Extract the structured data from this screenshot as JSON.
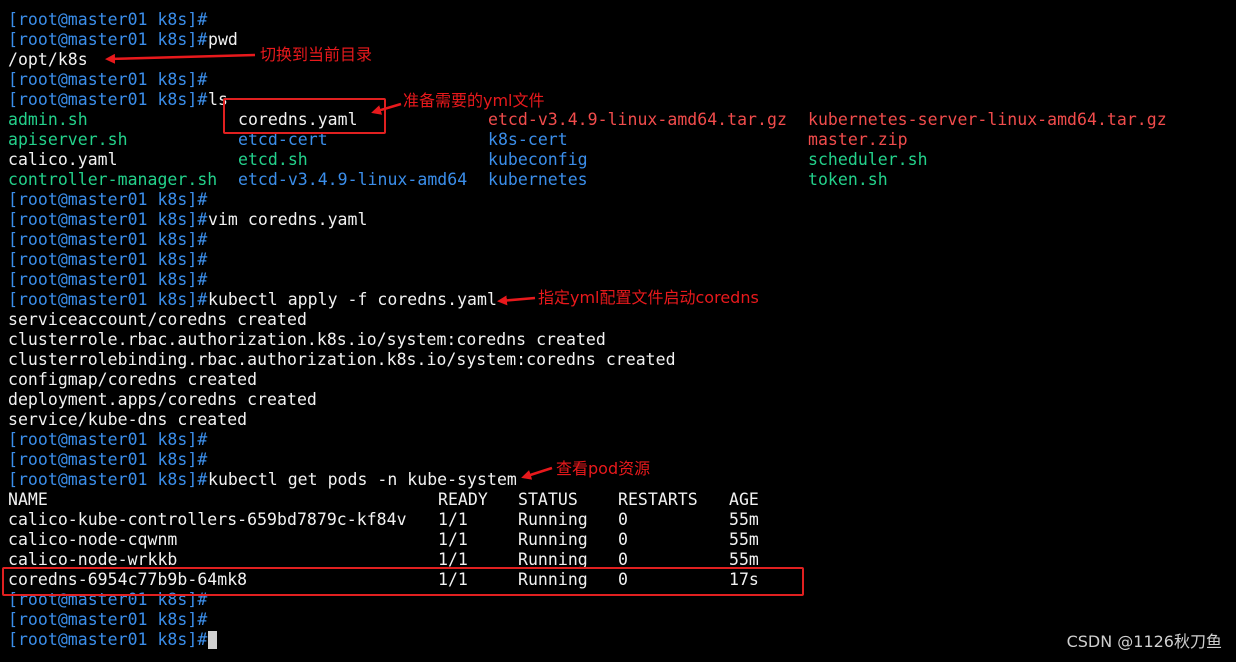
{
  "terminal": {
    "prompt": "[root@master01 k8s]#",
    "lines": [
      {
        "type": "prompt",
        "cmd": ""
      },
      {
        "type": "prompt",
        "cmd": "pwd"
      },
      {
        "type": "output",
        "text": "/opt/k8s"
      },
      {
        "type": "prompt",
        "cmd": ""
      },
      {
        "type": "prompt",
        "cmd": "ls"
      },
      {
        "type": "ls",
        "cells": [
          {
            "text": "admin.sh",
            "color": "green"
          },
          {
            "text": "coredns.yaml",
            "color": "white"
          },
          {
            "text": "etcd-v3.4.9-linux-amd64.tar.gz",
            "color": "red"
          },
          {
            "text": "kubernetes-server-linux-amd64.tar.gz",
            "color": "red"
          }
        ]
      },
      {
        "type": "ls",
        "cells": [
          {
            "text": "apiserver.sh",
            "color": "green"
          },
          {
            "text": "etcd-cert",
            "color": "blue"
          },
          {
            "text": "k8s-cert",
            "color": "blue"
          },
          {
            "text": "master.zip",
            "color": "red"
          }
        ]
      },
      {
        "type": "ls",
        "cells": [
          {
            "text": "calico.yaml",
            "color": "white"
          },
          {
            "text": "etcd.sh",
            "color": "green"
          },
          {
            "text": "kubeconfig",
            "color": "blue"
          },
          {
            "text": "scheduler.sh",
            "color": "green"
          }
        ]
      },
      {
        "type": "ls",
        "cells": [
          {
            "text": "controller-manager.sh",
            "color": "green"
          },
          {
            "text": "etcd-v3.4.9-linux-amd64",
            "color": "blue"
          },
          {
            "text": "kubernetes",
            "color": "blue"
          },
          {
            "text": "token.sh",
            "color": "green"
          }
        ]
      },
      {
        "type": "prompt",
        "cmd": ""
      },
      {
        "type": "prompt",
        "cmd": "vim coredns.yaml"
      },
      {
        "type": "prompt",
        "cmd": ""
      },
      {
        "type": "prompt",
        "cmd": ""
      },
      {
        "type": "prompt",
        "cmd": ""
      },
      {
        "type": "prompt",
        "cmd": "kubectl apply -f coredns.yaml"
      },
      {
        "type": "output",
        "text": "serviceaccount/coredns created"
      },
      {
        "type": "output",
        "text": "clusterrole.rbac.authorization.k8s.io/system:coredns created"
      },
      {
        "type": "output",
        "text": "clusterrolebinding.rbac.authorization.k8s.io/system:coredns created"
      },
      {
        "type": "output",
        "text": "configmap/coredns created"
      },
      {
        "type": "output",
        "text": "deployment.apps/coredns created"
      },
      {
        "type": "output",
        "text": "service/kube-dns created"
      },
      {
        "type": "prompt",
        "cmd": ""
      },
      {
        "type": "prompt",
        "cmd": ""
      },
      {
        "type": "prompt",
        "cmd": "kubectl get pods -n kube-system"
      },
      {
        "type": "table",
        "cells": [
          "NAME",
          "READY",
          "STATUS",
          "RESTARTS",
          "AGE"
        ]
      },
      {
        "type": "table",
        "cells": [
          "calico-kube-controllers-659bd7879c-kf84v",
          "1/1",
          "Running",
          "0",
          "55m"
        ]
      },
      {
        "type": "table",
        "cells": [
          "calico-node-cqwnm",
          "1/1",
          "Running",
          "0",
          "55m"
        ]
      },
      {
        "type": "table",
        "cells": [
          "calico-node-wrkkb",
          "1/1",
          "Running",
          "0",
          "55m"
        ]
      },
      {
        "type": "table",
        "cells": [
          "coredns-6954c77b9b-64mk8",
          "1/1",
          "Running",
          "0",
          "17s"
        ]
      },
      {
        "type": "prompt",
        "cmd": ""
      },
      {
        "type": "prompt",
        "cmd": ""
      },
      {
        "type": "prompt",
        "cmd": "",
        "cursor": true
      }
    ]
  },
  "annotations": {
    "switch_dir": "切换到当前目录",
    "prepare_yml": "准备需要的yml文件",
    "apply_yml": "指定yml配置文件启动coredns",
    "view_pods": "查看pod资源"
  },
  "colors": {
    "prompt": "#3b8eea",
    "green": "#23d18b",
    "blue": "#3b8eea",
    "red": "#f14c4c",
    "white": "#f2f2f2",
    "annotation": "#e8191c",
    "background": "#000000"
  },
  "watermark": "CSDN @1126秋刀鱼"
}
